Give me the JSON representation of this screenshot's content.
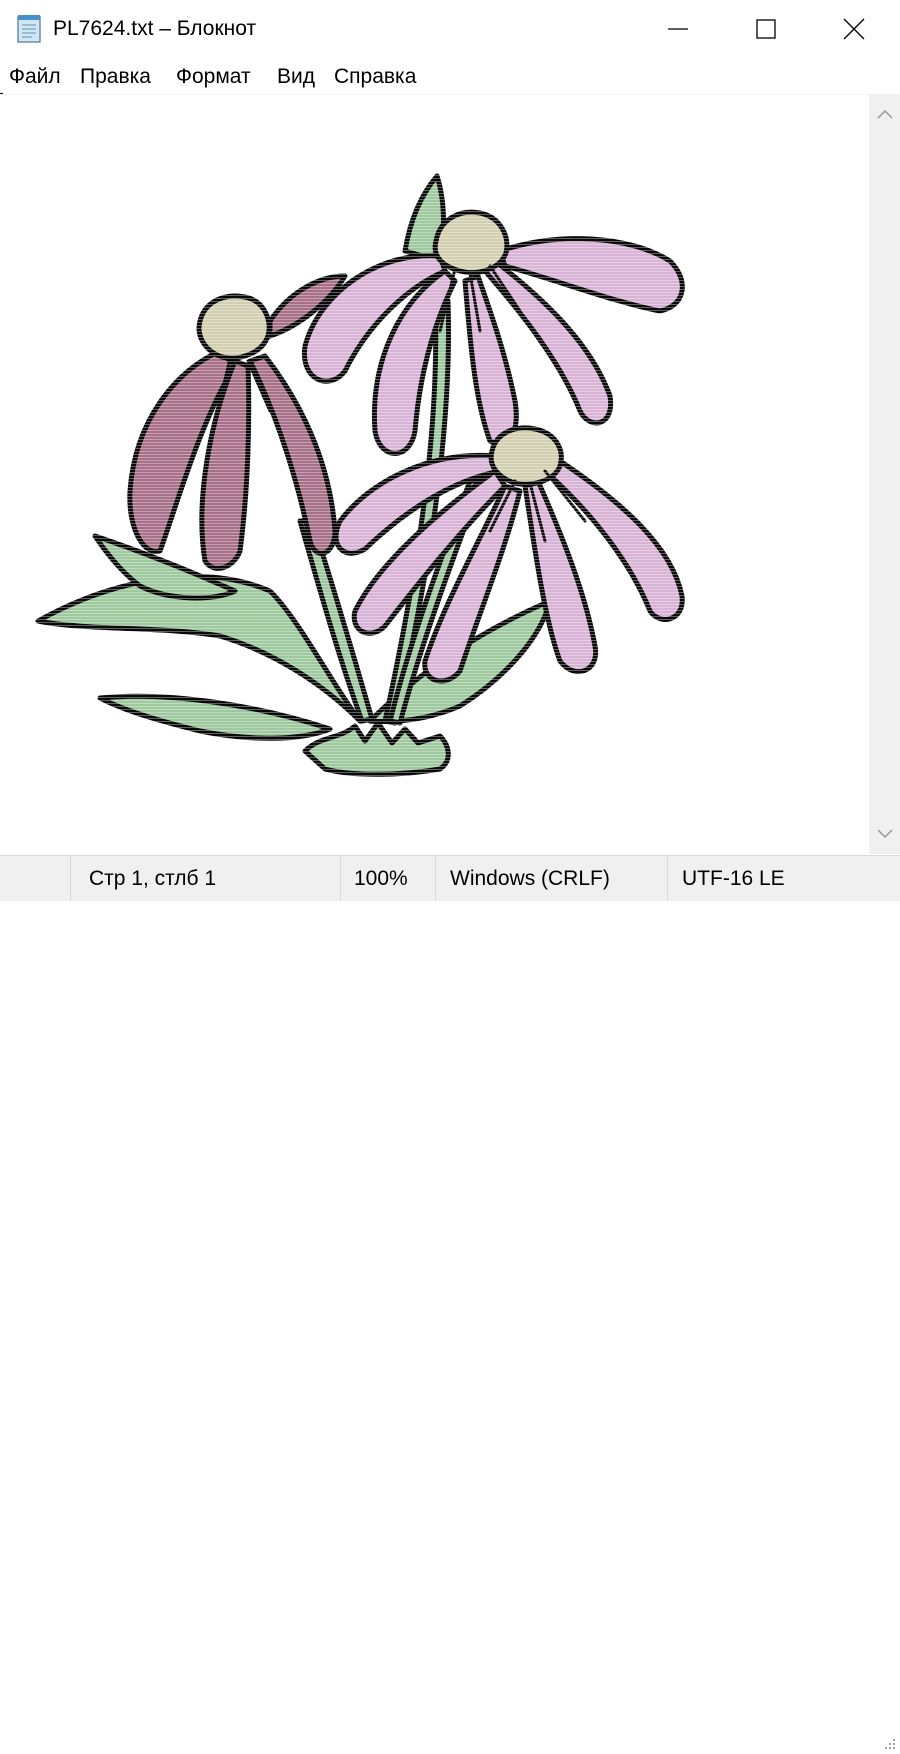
{
  "window": {
    "title": "PL7624.txt – Блокнот",
    "app_icon": "notepad-icon",
    "controls": [
      "minimize-icon",
      "maximize-icon",
      "close-icon"
    ]
  },
  "menu": {
    "items": [
      {
        "label": "Файл"
      },
      {
        "label": "Правка"
      },
      {
        "label": "Формат"
      },
      {
        "label": "Вид"
      },
      {
        "label": "Справка"
      }
    ]
  },
  "editor": {
    "content": "ascii-art-echinacea-flowers",
    "colors": {
      "outline": "#0a0a0a",
      "petal_pink": "#d9b3d6",
      "petal_mauve": "#a87088",
      "leaf_green": "#9ec99e",
      "flower_center": "#d2cfb0"
    }
  },
  "scrollbar": {
    "up_icon": "chevron-up-icon",
    "down_icon": "chevron-down-icon"
  },
  "status": {
    "position": "Стр 1, стлб 1",
    "zoom": "100%",
    "line_ending": "Windows (CRLF)",
    "encoding": "UTF-16 LE"
  }
}
